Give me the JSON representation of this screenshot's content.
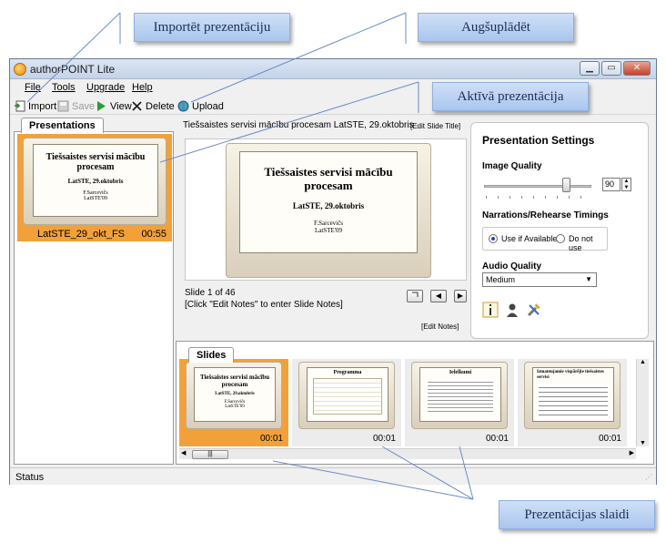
{
  "callouts": {
    "import": "Importēt prezentāciju",
    "upload": "Augšuplādēt",
    "active": "Aktīvā prezentācija",
    "slides": "Prezentācijas slaidi"
  },
  "window": {
    "title": "authorPOINT Lite",
    "minimize": "▁",
    "maximize": "▭",
    "close": "✕"
  },
  "menu": {
    "file": "File",
    "tools": "Tools",
    "upgrade": "Upgrade",
    "help": "Help"
  },
  "toolbar": {
    "import": "Import",
    "save": "Save",
    "view": "View",
    "delete": "Delete",
    "upload": "Upload"
  },
  "presentations": {
    "tab": "Presentations",
    "items": [
      {
        "name": "LatSTE_29_okt_FS",
        "duration": "00:55",
        "slide_title": "Tiešsaistes servisi mācību procesam",
        "slide_subtitle": "LatSTE, 29.oktobris",
        "slide_author": "F.Sarcevičs",
        "slide_footer": "LatSTE'09"
      }
    ]
  },
  "editor": {
    "slide_title": "Tiešsaistes servisi mācību procesam  LatSTE, 29.oktobris",
    "edit_title_link": "[Edit Slide Title]",
    "preview": {
      "title": "Tiešsaistes servisi mācību procesam",
      "subtitle": "LatSTE, 29.oktobris",
      "author": "F.Sarcevičs",
      "footer": "LatSTE'09"
    },
    "counter": "Slide 1 of 46",
    "notes_hint": "[Click \"Edit Notes\" to enter Slide Notes]",
    "edit_notes_link": "[Edit Notes]",
    "nav_prev": "◀",
    "nav_next": "▶"
  },
  "settings": {
    "title": "Presentation Settings",
    "image_quality_label": "Image Quality",
    "image_quality_value": "90",
    "image_quality_level": 90,
    "narrations_label": "Narrations/Rehearse Timings",
    "use_if_available": "Use if Available",
    "do_not_use": "Do not use",
    "audio_quality_label": "Audio Quality",
    "audio_quality_value": "Medium"
  },
  "slides_panel": {
    "tab": "Slides",
    "items": [
      {
        "title": "Tiešsaistes servisi mācību procesam",
        "sub": "LatSTE, 29.oktobris",
        "author": "F.Sarcevičs",
        "footer": "LatSTE'09",
        "duration": "00:01",
        "active": true
      },
      {
        "title": "Programma",
        "duration": "00:01",
        "active": false
      },
      {
        "title": "Ielelkumi",
        "duration": "00:01",
        "active": false
      },
      {
        "title": "Izmantojamie vispārējie tiešsaistes servisi",
        "duration": "00:01",
        "active": false
      }
    ],
    "scroll_grip": "|||"
  },
  "status": {
    "text": "Status"
  },
  "colors": {
    "accent_orange": "#f2a13a",
    "callout_bg": "#bcd3f3",
    "window_chrome": "#c4d3e8"
  }
}
